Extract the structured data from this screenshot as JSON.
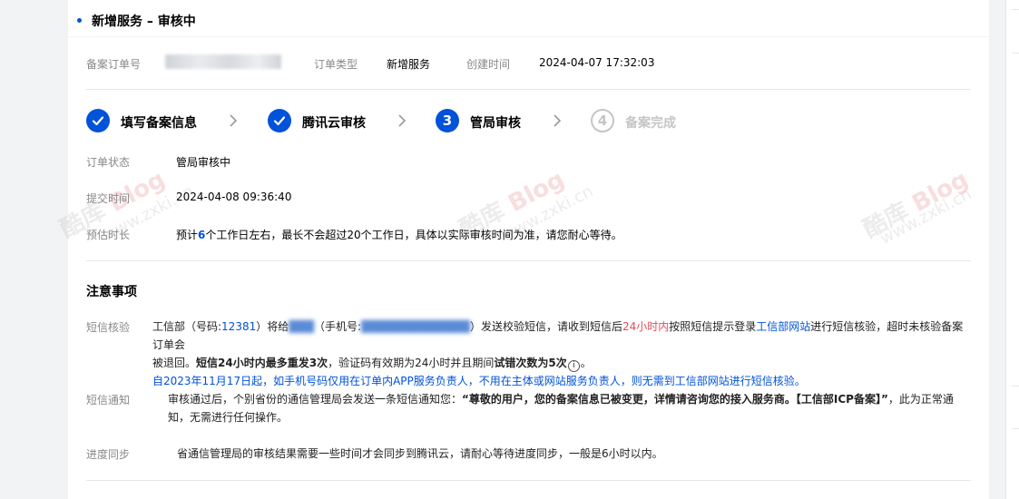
{
  "tab": {
    "title": "新增服务 – 审核中"
  },
  "header": {
    "order_no_label": "备案订单号",
    "order_type_label": "订单类型",
    "order_type_value": "新增服务",
    "created_label": "创建时间",
    "created_value": "2024-04-07 17:32:03"
  },
  "steps": [
    {
      "num": "1",
      "label": "填写备案信息",
      "state": "done"
    },
    {
      "num": "2",
      "label": "腾讯云审核",
      "state": "done"
    },
    {
      "num": "3",
      "label": "管局审核",
      "state": "active"
    },
    {
      "num": "4",
      "label": "备案完成",
      "state": "todo"
    }
  ],
  "status": {
    "state_label": "订单状态",
    "state_value": "管局审核中",
    "submit_label": "提交时间",
    "submit_value": "2024-04-08 09:36:40",
    "estimate_label": "预估时长",
    "estimate_prefix": "预计",
    "estimate_days": "6",
    "estimate_suffix": "个工作日左右，最长不会超过20个工作日，具体以实际审核时间为准，请您耐心等待。"
  },
  "notes": {
    "title": "注意事项",
    "sms_verify": {
      "label": "短信核验",
      "t1": "工信部（号码:",
      "phone": "12381",
      "t2": "）将给",
      "t3": "（手机号:",
      "t4": "）发送校验短信，请收到短信后",
      "deadline": "24小时内",
      "t5": "按照短信提示登录",
      "site": "工信部网站",
      "t6": "进行短信核验，超时未核验备案订单会",
      "t7": "被退回。",
      "bold1": "短信24小时内最多重发3次",
      "t8": "，验证码有效期为24小时并且期间",
      "bold2": "试错次数为5次",
      "t9": "。",
      "notice": "自2023年11月17日起，如手机号码仅用在订单内APP服务负责人，不用在主体或网站服务负责人，则无需到工信部网站进行短信核验。"
    },
    "sms_notify": {
      "label": "短信通知",
      "t1": "审核通过后，个别省份的通信管理局会发送一条短信通知您：",
      "quote": "“尊敬的用户，您的备案信息已被变更，详情请咨询您的接入服务商。【工信部ICP备案】”",
      "t2": "，此为正常通",
      "t3": "知，无需进行任何操作。"
    },
    "sync": {
      "label": "进度同步",
      "text": "省通信管理局的审核结果需要一些时间才会同步到腾讯云，请耐心等待进度同步，一般是6小时以内。"
    }
  },
  "watermark": {
    "brand": "酷库",
    "blog": "Blog",
    "url": "www.zxki.cn"
  }
}
